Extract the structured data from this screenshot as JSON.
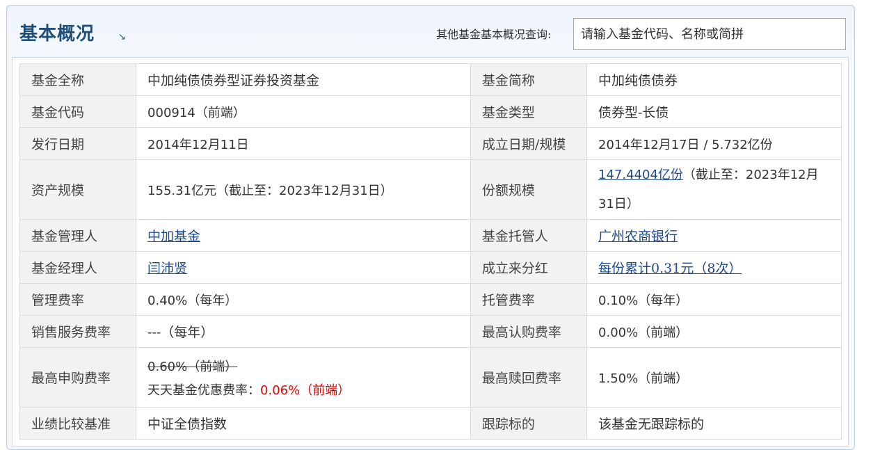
{
  "header": {
    "title": "基本概况",
    "title_arrow": "↘",
    "search_label": "其他基金基本概况查询:",
    "search_placeholder": "请输入基金代码、名称或简拼"
  },
  "rows": [
    {
      "l1": "基金全称",
      "v1": "中加纯债债券型证券投资基金",
      "l2": "基金简称",
      "v2": "中加纯债债券"
    },
    {
      "l1": "基金代码",
      "v1": "000914（前端）",
      "l2": "基金类型",
      "v2": "债券型-长债"
    },
    {
      "l1": "发行日期",
      "v1": "2014年12月11日",
      "l2": "成立日期/规模",
      "v2": "2014年12月17日 / 5.732亿份"
    },
    {
      "l1": "资产规模",
      "v1": "155.31亿元（截止至：2023年12月31日）",
      "l2": "份额规模",
      "v2_link": "147.4404亿份",
      "v2_rest": "（截止至：2023年12月31日）"
    },
    {
      "l1": "基金管理人",
      "v1_link": "中加基金",
      "l2": "基金托管人",
      "v2_link": "广州农商银行"
    },
    {
      "l1": "基金经理人",
      "v1_link": "闫沛贤",
      "l2": "成立来分红",
      "v2_link": "每份累计0.31元（8次）"
    },
    {
      "l1": "管理费率",
      "v1": "0.40%（每年）",
      "l2": "托管费率",
      "v2": "0.10%（每年）"
    },
    {
      "l1": "销售服务费率",
      "v1": "---（每年）",
      "l2": "最高认购费率",
      "v2": "0.00%（前端）"
    },
    {
      "l1": "最高申购费率",
      "v1_strike": "0.60%（前端）",
      "v1_discount_label": "天天基金优惠费率：",
      "v1_discount_value": "0.06%（前端）",
      "l2": "最高赎回费率",
      "v2": "1.50%（前端）"
    },
    {
      "l1": "业绩比较基准",
      "v1": "中证全债指数",
      "l2": "跟踪标的",
      "v2": "该基金无跟踪标的"
    }
  ],
  "colors": {
    "link": "#1d4a8c",
    "title": "#1f4e79",
    "discount": "#e60000"
  }
}
